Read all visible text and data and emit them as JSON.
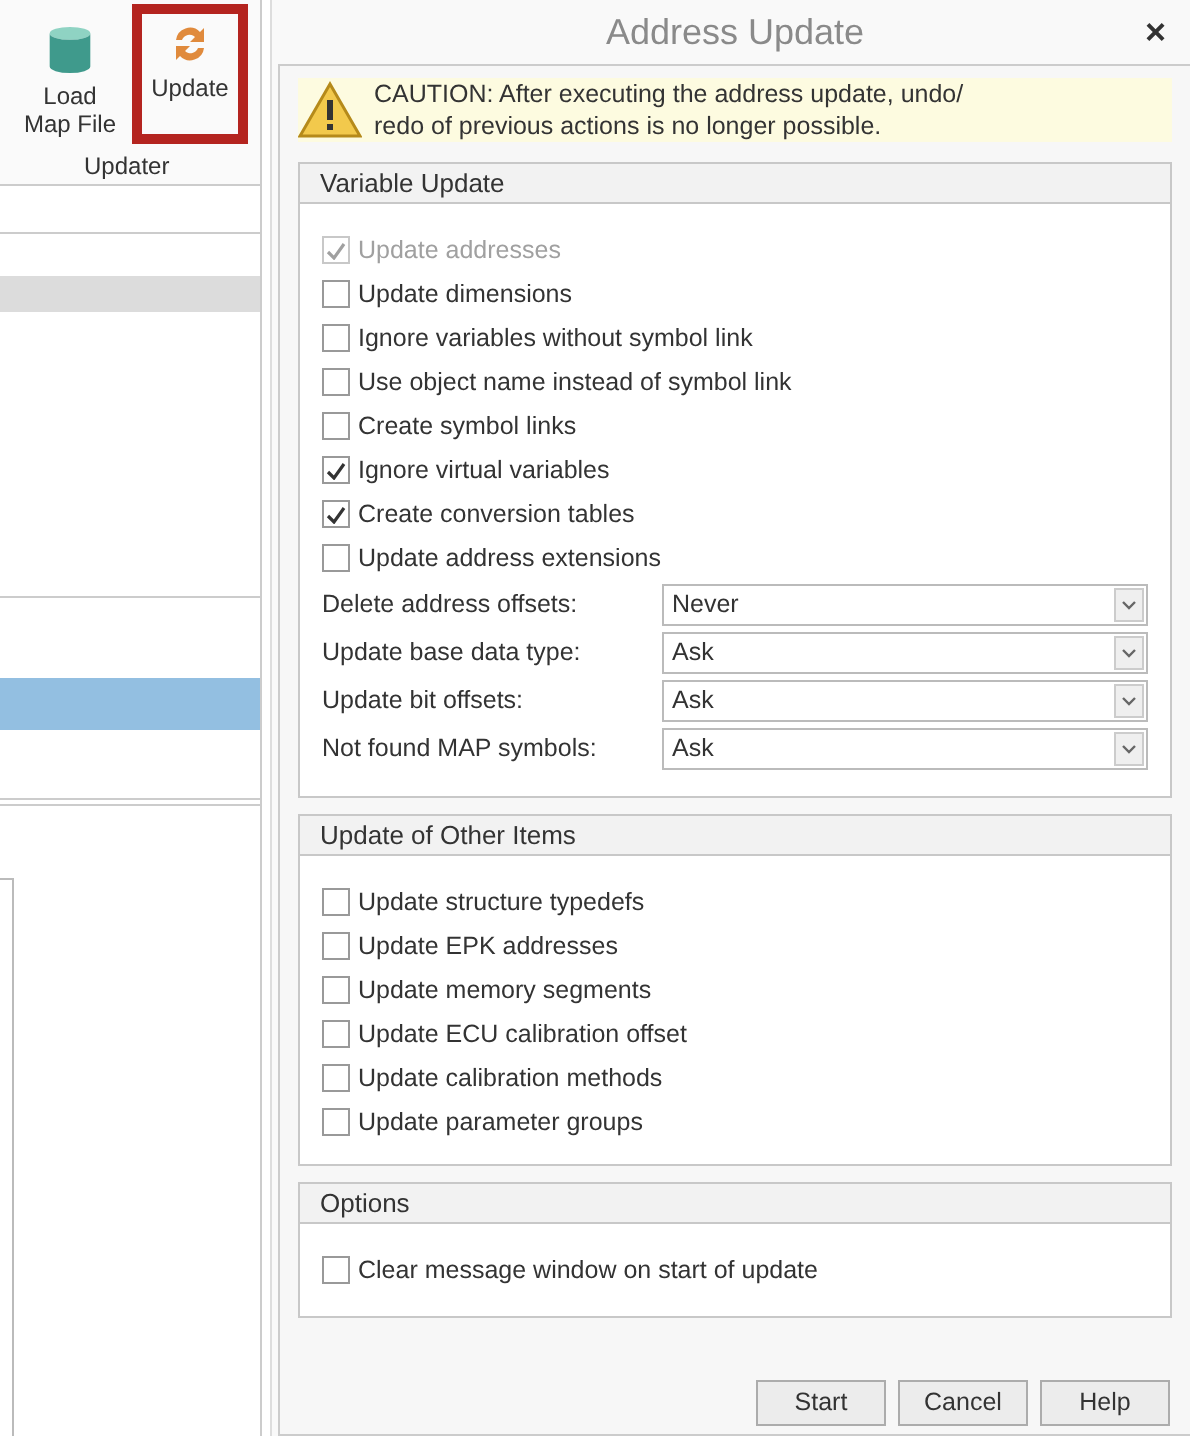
{
  "ribbon": {
    "buttons": [
      {
        "label": "Load Map File",
        "kind": "map",
        "selected": false
      },
      {
        "label": "Update",
        "kind": "update",
        "selected": true
      }
    ],
    "group_label": "Updater"
  },
  "dialog": {
    "title": "Address Update",
    "close": "×",
    "caution": "CAUTION: After executing the address update, undo/ redo of previous actions is no longer possible.",
    "groups": [
      {
        "title": "Variable Update",
        "checkboxes": [
          {
            "label": "Update addresses",
            "checked": true,
            "disabled": true
          },
          {
            "label": "Update dimensions",
            "checked": false,
            "disabled": false
          },
          {
            "label": "Ignore variables without symbol link",
            "checked": false,
            "disabled": false
          },
          {
            "label": "Use object name instead of symbol link",
            "checked": false,
            "disabled": false
          },
          {
            "label": "Create symbol links",
            "checked": false,
            "disabled": false
          },
          {
            "label": "Ignore virtual variables",
            "checked": true,
            "disabled": false
          },
          {
            "label": "Create conversion tables",
            "checked": true,
            "disabled": false
          },
          {
            "label": "Update address extensions",
            "checked": false,
            "disabled": false
          }
        ],
        "dropdowns": [
          {
            "label": "Delete address offsets:",
            "value": "Never"
          },
          {
            "label": "Update base data type:",
            "value": "Ask"
          },
          {
            "label": "Update bit offsets:",
            "value": "Ask"
          },
          {
            "label": "Not found MAP symbols:",
            "value": "Ask"
          }
        ]
      },
      {
        "title": "Update of Other Items",
        "checkboxes": [
          {
            "label": "Update structure typedefs",
            "checked": false,
            "disabled": false
          },
          {
            "label": "Update EPK addresses",
            "checked": false,
            "disabled": false
          },
          {
            "label": "Update memory segments",
            "checked": false,
            "disabled": false
          },
          {
            "label": "Update ECU calibration offset",
            "checked": false,
            "disabled": false
          },
          {
            "label": "Update calibration methods",
            "checked": false,
            "disabled": false
          },
          {
            "label": "Update parameter groups",
            "checked": false,
            "disabled": false
          }
        ]
      },
      {
        "title": "Options",
        "checkboxes": [
          {
            "label": "Clear message window on start of update",
            "checked": false,
            "disabled": false
          }
        ]
      }
    ],
    "buttons": [
      "Start",
      "Cancel",
      "Help"
    ]
  }
}
